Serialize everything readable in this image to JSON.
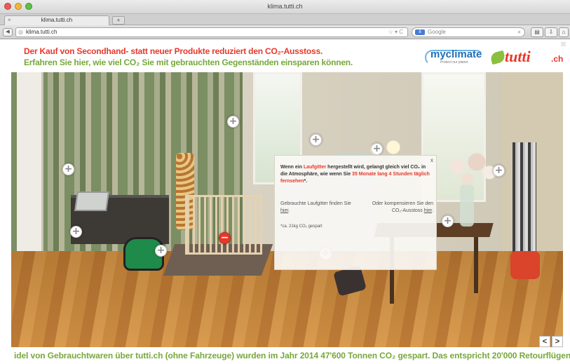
{
  "window": {
    "title": "klima.tutti.ch"
  },
  "tab": {
    "label": "klima.tutti.ch",
    "new_tab": "+"
  },
  "address": {
    "url": "klima.tutti.ch",
    "search_placeholder": "Google",
    "search_badge": "8"
  },
  "header": {
    "headline_line1": "Der Kauf von Secondhand- statt neuer Produkte reduziert den CO₂-Ausstoss.",
    "headline_line2": "Erfahren Sie hier, wie viel CO₂ Sie mit gebrauchten Gegenständen einsparen können.",
    "myclimate_logo": "myclimate",
    "myclimate_tagline": "Protect our planet",
    "tutti_logo": "tutti",
    "tutti_suffix": ".ch",
    "accent_red": "#e8372a",
    "accent_green": "#76a83a"
  },
  "popup": {
    "text_part1": "Wenn ein ",
    "text_item": "Laufgitter",
    "text_part2": " hergestellt wird, gelangt gleich viel CO₂ in die Atmosphäre, wie wenn Sie ",
    "text_highlight": "35 Monate lang 4 Stunden täglich fernsehen",
    "text_part3": "*.",
    "col1_text": "Gebrauchte Laufgitter finden Sie ",
    "col1_link": "hier",
    "col1_end": ".",
    "col2_text": "Oder kompensieren Sie den CO₂-Ausstoss ",
    "col2_link": "hier",
    "col2_end": ".",
    "footnote": "*ca. 21kg CO₂ gespart",
    "close": "x"
  },
  "nav": {
    "prev": "<",
    "next": ">"
  },
  "ticker": {
    "text": "idel von Gebrauchtwaren über tutti.ch (ohne Fahrzeuge) wurden im Jahr 2014 47'600 Tonnen CO₂ gespart. Das entspricht 20'000 Retourflügen Zürich - Ne"
  },
  "hotspot_icon": "plus-icon",
  "hotspot_symbol": "+"
}
